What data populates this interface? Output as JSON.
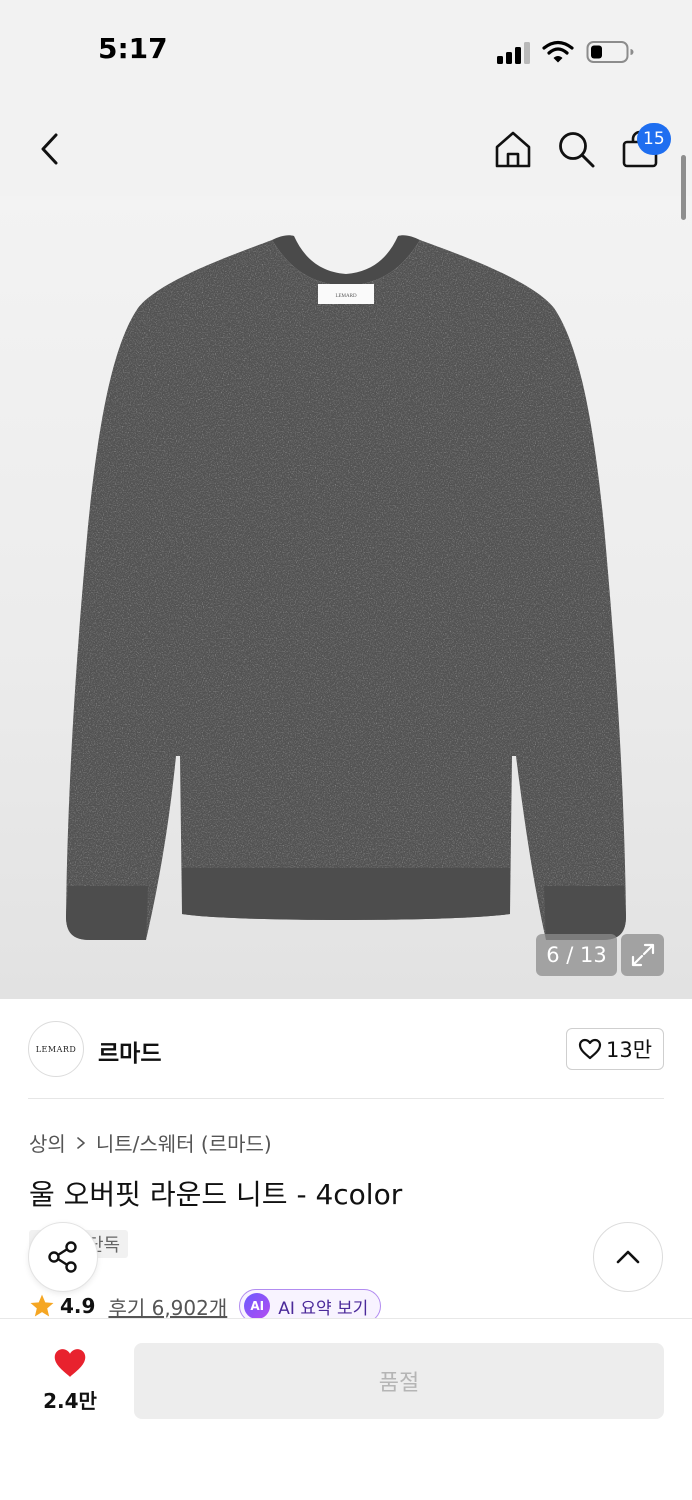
{
  "status_bar": {
    "time": "5:17",
    "icons": [
      "cellular-signal-icon",
      "wifi-icon",
      "battery-icon"
    ]
  },
  "header": {
    "icons": [
      "back-arrow-icon",
      "home-icon",
      "search-icon",
      "shopping-bag-icon"
    ],
    "cart_count": "15"
  },
  "gallery": {
    "image": "grey-wool-round-knit-sweater",
    "label_text": "LEMARD",
    "counter": "6 / 13",
    "expand_icon": "expand-arrows-icon"
  },
  "brand": {
    "logo_text": "LEMARD",
    "name": "르마드",
    "likes": "13만",
    "like_icon": "heart-outline-icon"
  },
  "product": {
    "breadcrumb": [
      "상의",
      "니트/스웨터 (르마드)"
    ],
    "title": "울 오버핏 라운드 니트 - 4color",
    "tag": "단독"
  },
  "rating": {
    "score": "4.9",
    "reviews": "후기 6,902개",
    "ai_badge": "AI",
    "ai_summary_label": "AI 요약 보기"
  },
  "fabs": {
    "share_icon": "share-icon",
    "top_icon": "chevron-up-icon"
  },
  "bottom_bar": {
    "wish_count": "2.4만",
    "soldout_label": "품절"
  },
  "colors": {
    "accent_blue": "#1e6ef0",
    "heart_red": "#e8222e",
    "star_orange": "#f5a623",
    "ai_purple": "#8a5cf0"
  }
}
